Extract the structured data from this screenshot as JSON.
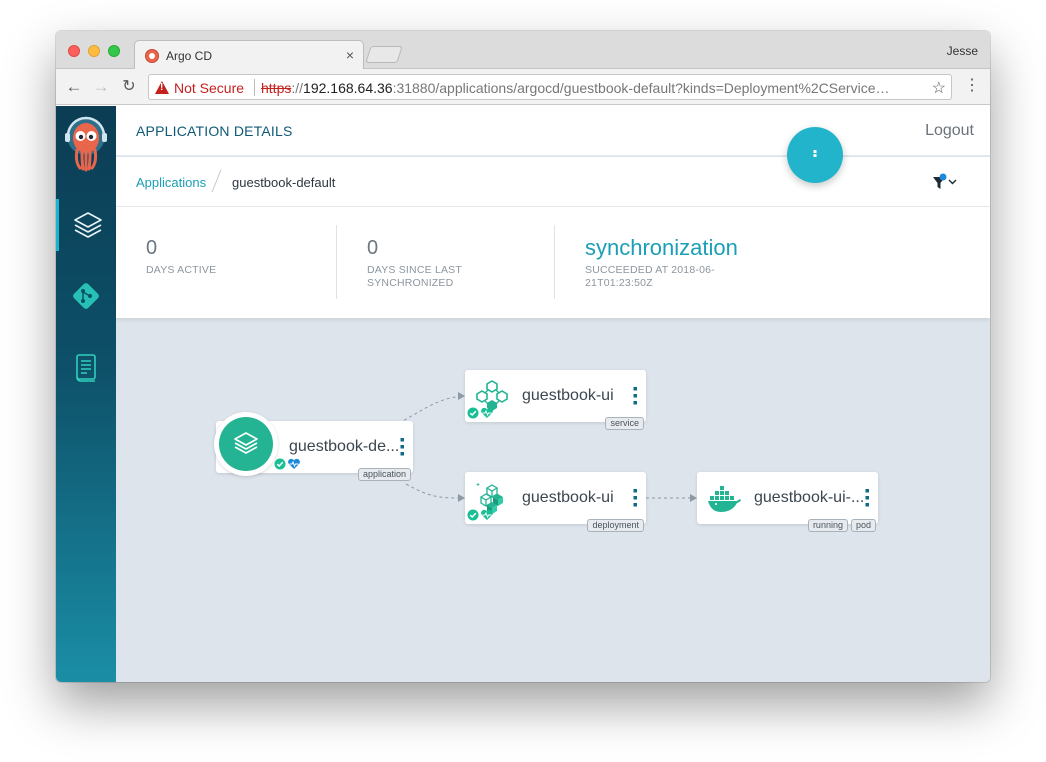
{
  "browser": {
    "tab_title": "Argo CD",
    "tab_close": "×",
    "profile": "Jesse",
    "security_label": "Not Secure",
    "url_scheme": "https",
    "url_sep": "://",
    "url_host": "192.168.64.36",
    "url_rest": ":31880/applications/argocd/guestbook-default?kinds=Deployment%2CService…",
    "back": "←",
    "forward": "→",
    "reload": "↻",
    "star": "☆",
    "menu": "⋮"
  },
  "header": {
    "title": "APPLICATION DETAILS",
    "logout": "Logout"
  },
  "breadcrumb": {
    "parent": "Applications",
    "current": "guestbook-default"
  },
  "stats": [
    {
      "value": "0",
      "label": "DAYS ACTIVE"
    },
    {
      "value": "0",
      "label": "DAYS SINCE LAST SYNCHRONIZED"
    },
    {
      "value": "synchronization",
      "label": "SUCCEEDED AT 2018-06-21T01:23:50Z"
    }
  ],
  "graph": {
    "app_node": {
      "label": "guestbook-de...",
      "tags": [
        "application"
      ]
    },
    "service_node": {
      "label": "guestbook-ui",
      "tags": [
        "service"
      ]
    },
    "deployment_node": {
      "label": "guestbook-ui",
      "tags": [
        "deployment"
      ]
    },
    "pod_node": {
      "label": "guestbook-ui-...",
      "tags": [
        "running",
        "pod"
      ]
    }
  },
  "sidebar": {
    "items": [
      {
        "icon": "applications-icon"
      },
      {
        "icon": "repositories-icon"
      },
      {
        "icon": "docs-icon"
      }
    ]
  },
  "colors": {
    "accent": "#1a9fb6",
    "healthy": "#25b493",
    "sidebar_top": "#0b3d54",
    "sidebar_bottom": "#1a8ea6",
    "fab": "#22b4ca"
  }
}
